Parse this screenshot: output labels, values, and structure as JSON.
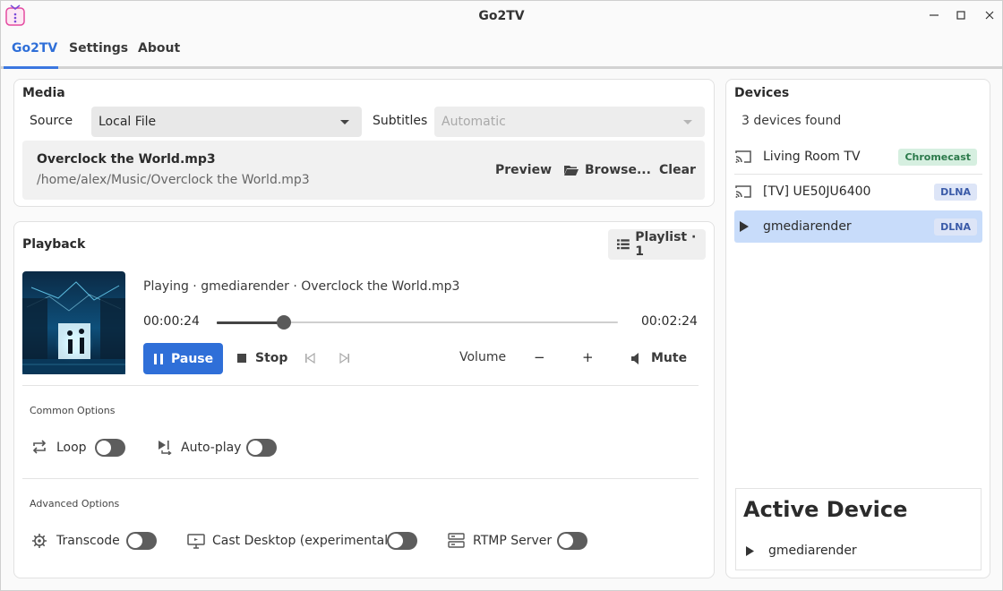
{
  "window": {
    "title": "Go2TV"
  },
  "tabs": [
    {
      "label": "Go2TV",
      "active": true
    },
    {
      "label": "Settings",
      "active": false
    },
    {
      "label": "About",
      "active": false
    }
  ],
  "media": {
    "title": "Media",
    "source_label": "Source",
    "source_value": "Local File",
    "subtitles_label": "Subtitles",
    "subtitles_value": "Automatic",
    "file_name": "Overclock the World.mp3",
    "file_path": "/home/alex/Music/Overclock the World.mp3",
    "preview_label": "Preview",
    "browse_label": "Browse...",
    "clear_label": "Clear"
  },
  "playback": {
    "title": "Playback",
    "playlist_label": "Playlist · 1",
    "now_playing": "Playing · gmediarender · Overclock the World.mp3",
    "elapsed": "00:00:24",
    "duration": "00:02:24",
    "progress": 0.1667,
    "pause_label": "Pause",
    "stop_label": "Stop",
    "volume_label": "Volume",
    "vol_down": "−",
    "vol_up": "+",
    "mute_label": "Mute"
  },
  "common_options": {
    "title": "Common Options",
    "loop_label": "Loop",
    "loop_on": false,
    "autoplay_label": "Auto-play",
    "autoplay_on": false
  },
  "advanced_options": {
    "title": "Advanced Options",
    "transcode_label": "Transcode",
    "transcode_on": false,
    "cast_desktop_label": "Cast Desktop (experimental)",
    "cast_desktop_on": false,
    "rtmp_label": "RTMP Server",
    "rtmp_on": false
  },
  "devices": {
    "title": "Devices",
    "count_text": "3 devices found",
    "items": [
      {
        "name": "Living Room TV",
        "type": "Chromecast",
        "icon": "cast-icon",
        "selected": false
      },
      {
        "name": "[TV] UE50JU6400",
        "type": "DLNA",
        "icon": "cast-icon",
        "selected": false
      },
      {
        "name": "gmediarender",
        "type": "DLNA",
        "icon": "play-icon",
        "selected": true
      }
    ],
    "active_title": "Active Device",
    "active_name": "gmediarender"
  },
  "colors": {
    "accent": "#2f6fd8",
    "selection": "#c8dcfa",
    "chromecast_badge_bg": "#d6efe0",
    "chromecast_badge_fg": "#2c7a4b",
    "dlna_badge_bg": "#dde5f7",
    "dlna_badge_fg": "#3a5aa8"
  }
}
